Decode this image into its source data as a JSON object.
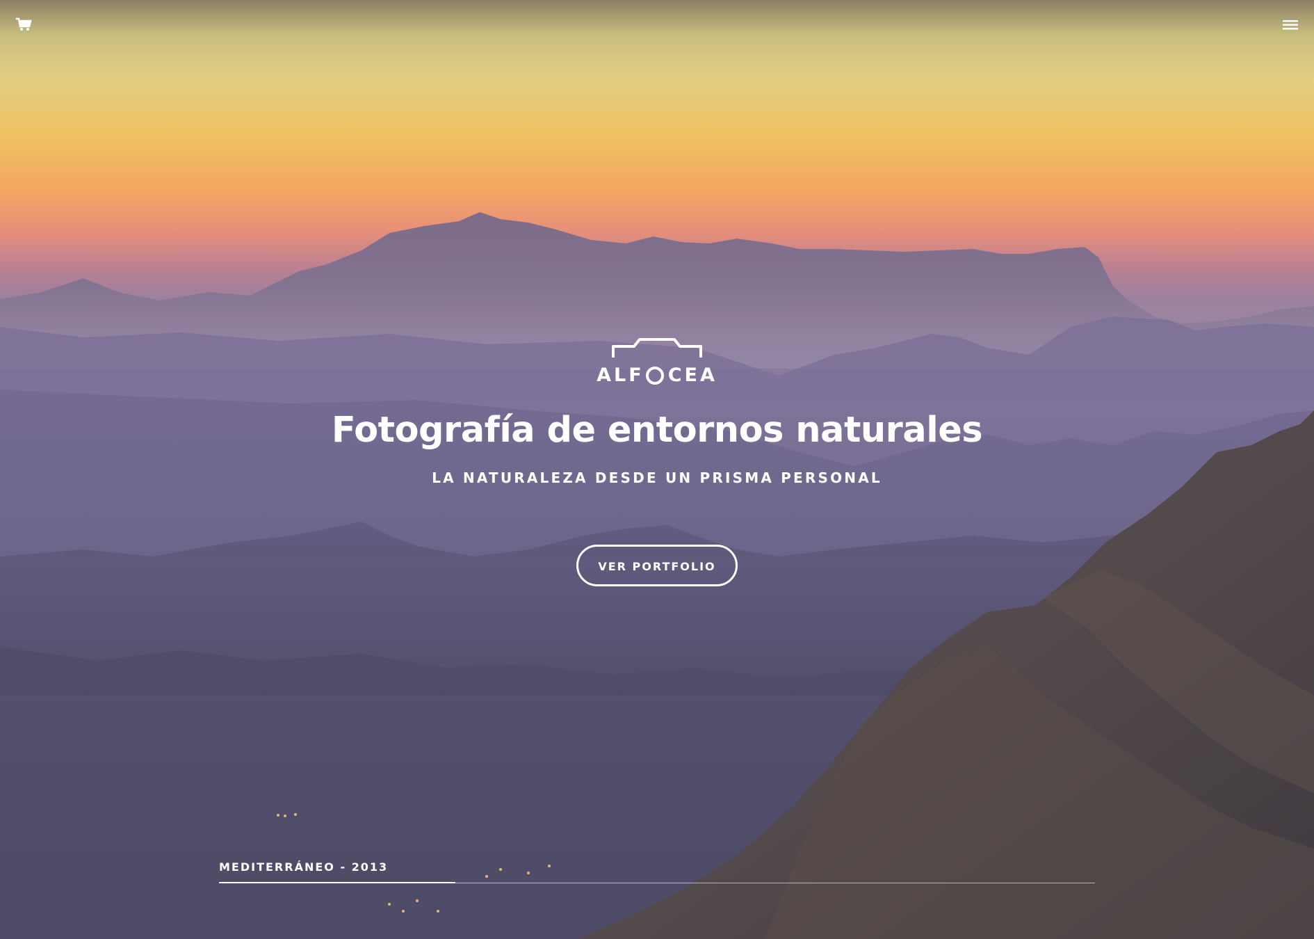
{
  "header": {
    "cart_icon": "shopping-cart-icon",
    "menu_icon": "hamburger-menu-icon"
  },
  "hero": {
    "logo_text_left": "ALF",
    "logo_text_right": "CEA",
    "headline": "Fotografía de entornos naturales",
    "subheadline": "LA NATURALEZA DESDE UN PRISMA PERSONAL",
    "cta_label": "VER PORTFOLIO"
  },
  "slide": {
    "caption": "MEDITERRÁNEO - 2013",
    "progress": 0.27
  },
  "colors": {
    "text": "#ffffff",
    "sky_top": "#c8bd7d",
    "sky_glow": "#f0c060",
    "mist": "#8f7f9f",
    "valley": "#4a4860"
  }
}
